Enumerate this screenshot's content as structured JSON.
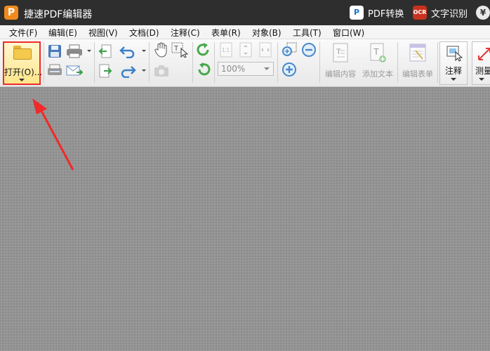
{
  "titlebar": {
    "logo_letter": "P",
    "app_title": "捷速PDF编辑器",
    "pdf_convert_label": "PDF转换",
    "ocr_badge": "OCR",
    "ocr_label": "文字识别",
    "yen_symbol": "¥"
  },
  "menu": {
    "items": [
      {
        "label": "文件(F)"
      },
      {
        "label": "编辑(E)"
      },
      {
        "label": "视图(V)"
      },
      {
        "label": "文档(D)"
      },
      {
        "label": "注释(C)"
      },
      {
        "label": "表单(R)"
      },
      {
        "label": "对象(B)"
      },
      {
        "label": "工具(T)"
      },
      {
        "label": "窗口(W)"
      }
    ]
  },
  "toolbar": {
    "open_label": "打开(O)...",
    "zoom_value": "100%",
    "edit_content_label": "编辑内容",
    "add_text_label": "添加文本",
    "edit_form_label": "编辑表单",
    "annotate_label": "注释",
    "measure_label": "测量"
  },
  "icons": {
    "open": "folder-icon",
    "save": "save-icon",
    "print": "printer-icon",
    "scan": "scanner-icon",
    "email": "email-icon",
    "prev_page": "page-back-icon",
    "next_page": "page-forward-icon",
    "undo": "undo-icon",
    "redo": "redo-icon",
    "hand": "hand-icon",
    "select_text": "text-select-icon",
    "snapshot": "camera-icon",
    "rotate_cw": "rotate-clockwise-icon",
    "rotate_ccw": "rotate-counterclockwise-icon",
    "actual_size": "actual-size-icon",
    "fit_page": "fit-page-icon",
    "fit_width": "fit-width-icon",
    "zoom_in": "zoom-in-icon",
    "zoom_out": "zoom-out-icon",
    "zoom_tool": "zoom-tool-icon"
  },
  "colors": {
    "titlebar_bg": "#2e2e2e",
    "app_logo": "#f08a1c",
    "highlight_border": "#ee2a2a",
    "workspace_bg": "#939393"
  }
}
